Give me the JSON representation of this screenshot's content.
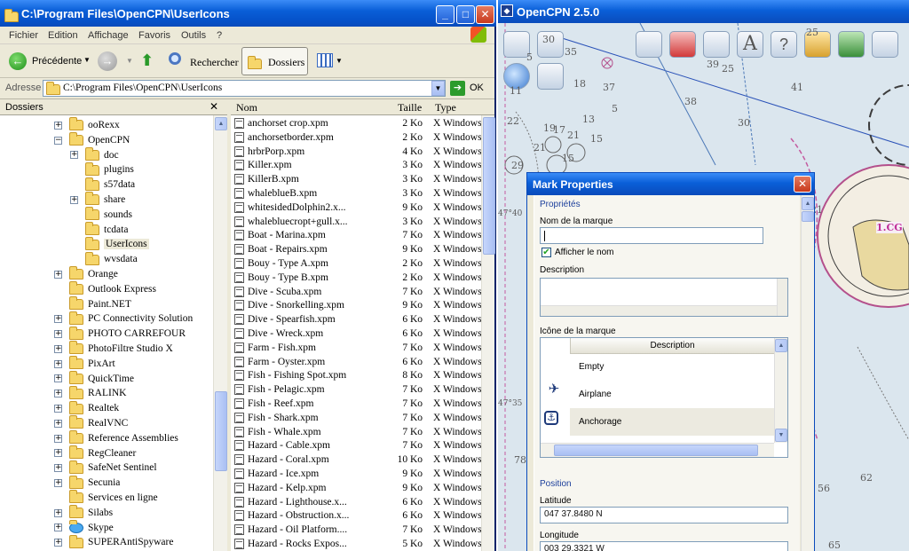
{
  "explorer": {
    "title": "C:\\Program Files\\OpenCPN\\UserIcons",
    "menu": [
      "Fichier",
      "Edition",
      "Affichage",
      "Favoris",
      "Outils",
      "?"
    ],
    "toolbar": {
      "back": "Précédente",
      "search": "Rechercher",
      "folders": "Dossiers"
    },
    "address": {
      "label": "Adresse",
      "value": "C:\\Program Files\\OpenCPN\\UserIcons",
      "go": "OK"
    },
    "folders_header": "Dossiers",
    "tree": [
      {
        "label": "ooRexx",
        "level": 0,
        "toggle": "+"
      },
      {
        "label": "OpenCPN",
        "level": 0,
        "toggle": "−"
      },
      {
        "label": "doc",
        "level": 1,
        "toggle": "+"
      },
      {
        "label": "plugins",
        "level": 1,
        "toggle": ""
      },
      {
        "label": "s57data",
        "level": 1,
        "toggle": ""
      },
      {
        "label": "share",
        "level": 1,
        "toggle": "+"
      },
      {
        "label": "sounds",
        "level": 1,
        "toggle": ""
      },
      {
        "label": "tcdata",
        "level": 1,
        "toggle": ""
      },
      {
        "label": "UserIcons",
        "level": 1,
        "toggle": "",
        "selected": true
      },
      {
        "label": "wvsdata",
        "level": 1,
        "toggle": ""
      },
      {
        "label": "Orange",
        "level": 0,
        "toggle": "+"
      },
      {
        "label": "Outlook Express",
        "level": 0,
        "toggle": ""
      },
      {
        "label": "Paint.NET",
        "level": 0,
        "toggle": ""
      },
      {
        "label": "PC Connectivity Solution",
        "level": 0,
        "toggle": "+"
      },
      {
        "label": "PHOTO CARREFOUR",
        "level": 0,
        "toggle": "+"
      },
      {
        "label": "PhotoFiltre Studio X",
        "level": 0,
        "toggle": "+"
      },
      {
        "label": "PixArt",
        "level": 0,
        "toggle": "+"
      },
      {
        "label": "QuickTime",
        "level": 0,
        "toggle": "+"
      },
      {
        "label": "RALINK",
        "level": 0,
        "toggle": "+"
      },
      {
        "label": "Realtek",
        "level": 0,
        "toggle": "+"
      },
      {
        "label": "RealVNC",
        "level": 0,
        "toggle": "+"
      },
      {
        "label": "Reference Assemblies",
        "level": 0,
        "toggle": "+"
      },
      {
        "label": "RegCleaner",
        "level": 0,
        "toggle": "+"
      },
      {
        "label": "SafeNet Sentinel",
        "level": 0,
        "toggle": "+"
      },
      {
        "label": "Secunia",
        "level": 0,
        "toggle": "+"
      },
      {
        "label": "Services en ligne",
        "level": 0,
        "toggle": ""
      },
      {
        "label": "Silabs",
        "level": 0,
        "toggle": "+"
      },
      {
        "label": "Skype",
        "level": 0,
        "toggle": "+"
      },
      {
        "label": "SUPERAntiSpyware",
        "level": 0,
        "toggle": "+"
      }
    ],
    "columns": {
      "name": "Nom",
      "size": "Taille",
      "type": "Type"
    },
    "files": [
      {
        "name": "anchorset crop.xpm",
        "size": "2 Ko",
        "type": "X Windows"
      },
      {
        "name": "anchorsetborder.xpm",
        "size": "2 Ko",
        "type": "X Windows"
      },
      {
        "name": "hrbrPorp.xpm",
        "size": "4 Ko",
        "type": "X Windows"
      },
      {
        "name": "Killer.xpm",
        "size": "3 Ko",
        "type": "X Windows"
      },
      {
        "name": "KillerB.xpm",
        "size": "3 Ko",
        "type": "X Windows"
      },
      {
        "name": "whaleblueB.xpm",
        "size": "3 Ko",
        "type": "X Windows"
      },
      {
        "name": "whitesidedDolphin2.x...",
        "size": "9 Ko",
        "type": "X Windows"
      },
      {
        "name": "whalebluecropt+gull.x...",
        "size": "3 Ko",
        "type": "X Windows"
      },
      {
        "name": "Boat - Marina.xpm",
        "size": "7 Ko",
        "type": "X Windows"
      },
      {
        "name": "Boat - Repairs.xpm",
        "size": "9 Ko",
        "type": "X Windows"
      },
      {
        "name": "Bouy - Type A.xpm",
        "size": "2 Ko",
        "type": "X Windows"
      },
      {
        "name": "Bouy - Type B.xpm",
        "size": "2 Ko",
        "type": "X Windows"
      },
      {
        "name": "Dive - Scuba.xpm",
        "size": "7 Ko",
        "type": "X Windows"
      },
      {
        "name": "Dive - Snorkelling.xpm",
        "size": "9 Ko",
        "type": "X Windows"
      },
      {
        "name": "Dive - Spearfish.xpm",
        "size": "6 Ko",
        "type": "X Windows"
      },
      {
        "name": "Dive - Wreck.xpm",
        "size": "6 Ko",
        "type": "X Windows"
      },
      {
        "name": "Farm - Fish.xpm",
        "size": "7 Ko",
        "type": "X Windows"
      },
      {
        "name": "Farm - Oyster.xpm",
        "size": "6 Ko",
        "type": "X Windows"
      },
      {
        "name": "Fish - Fishing Spot.xpm",
        "size": "8 Ko",
        "type": "X Windows"
      },
      {
        "name": "Fish - Pelagic.xpm",
        "size": "7 Ko",
        "type": "X Windows"
      },
      {
        "name": "Fish - Reef.xpm",
        "size": "7 Ko",
        "type": "X Windows"
      },
      {
        "name": "Fish - Shark.xpm",
        "size": "7 Ko",
        "type": "X Windows"
      },
      {
        "name": "Fish - Whale.xpm",
        "size": "7 Ko",
        "type": "X Windows"
      },
      {
        "name": "Hazard - Cable.xpm",
        "size": "7 Ko",
        "type": "X Windows"
      },
      {
        "name": "Hazard - Coral.xpm",
        "size": "10 Ko",
        "type": "X Windows"
      },
      {
        "name": "Hazard - Ice.xpm",
        "size": "9 Ko",
        "type": "X Windows"
      },
      {
        "name": "Hazard - Kelp.xpm",
        "size": "9 Ko",
        "type": "X Windows"
      },
      {
        "name": "Hazard - Lighthouse.x...",
        "size": "6 Ko",
        "type": "X Windows"
      },
      {
        "name": "Hazard - Obstruction.x...",
        "size": "6 Ko",
        "type": "X Windows"
      },
      {
        "name": "Hazard - Oil Platform....",
        "size": "7 Ko",
        "type": "X Windows"
      },
      {
        "name": "Hazard - Rocks Expos...",
        "size": "5 Ko",
        "type": "X Windows"
      }
    ]
  },
  "opencpn": {
    "title": "OpenCPN 2.5.0",
    "depths": [
      "30",
      "5",
      "35",
      "25",
      "37",
      "38",
      "30",
      "41",
      "39",
      "25",
      "11",
      "19",
      "21",
      "17",
      "22",
      "29",
      "21",
      "15",
      "13",
      "18",
      "15",
      "5",
      "47°40",
      "21",
      "1.CG",
      "47°35",
      "78",
      "66",
      "56",
      "68",
      "62",
      "65"
    ]
  },
  "dialog": {
    "title": "Mark Properties",
    "section_props": "Propriétés",
    "name_label": "Nom de la marque",
    "name_value": "",
    "show_name": "Afficher le nom",
    "desc_label": "Description",
    "icon_label": "Icône de la marque",
    "icon_col": "Description",
    "icons": [
      "Empty",
      "Airplane",
      "Anchorage"
    ],
    "section_pos": "Position",
    "lat_label": "Latitude",
    "lat_value": "047 37.8480 N",
    "lon_label": "Longitude",
    "lon_value": "003 29.3321 W"
  }
}
